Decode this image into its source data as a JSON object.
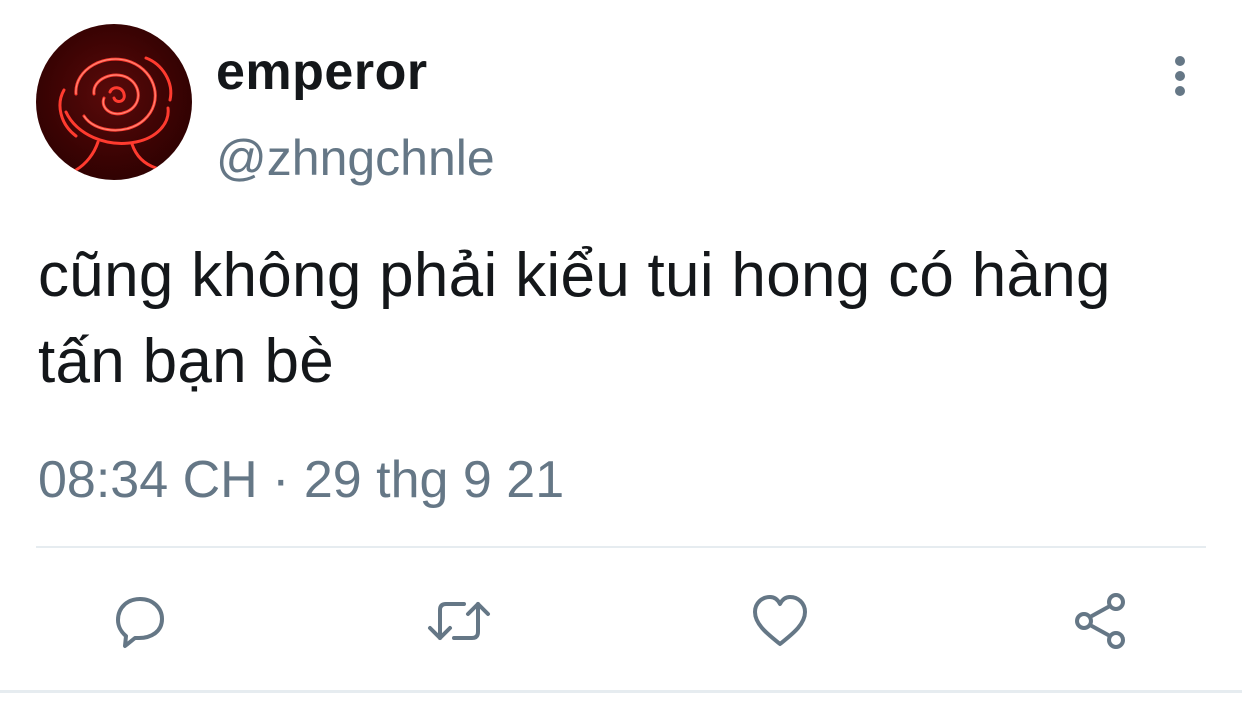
{
  "tweet": {
    "display_name": "emperor",
    "handle": "@zhngchnle",
    "text": "cũng không phải kiểu tui hong có hàng tấn bạn bè",
    "timestamp": "08:34 CH · 29 thg 9 21"
  },
  "icons": {
    "avatar": "neon-rose-avatar",
    "more": "more-vertical-icon",
    "reply": "reply-icon",
    "retweet": "retweet-icon",
    "like": "heart-icon",
    "share": "share-icon"
  },
  "colors": {
    "text_primary": "#14171a",
    "text_secondary": "#657786",
    "divider": "#e6ecf0",
    "icon": "#657786"
  }
}
